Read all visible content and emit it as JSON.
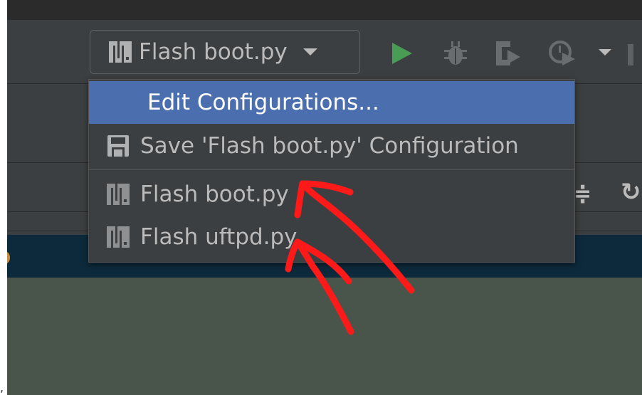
{
  "toolbar": {
    "run_config_label": "Flash boot.py",
    "run_config_icon": "micropython-icon",
    "actions": [
      {
        "name": "run",
        "icon": "run-icon",
        "color": "#499c54"
      },
      {
        "name": "debug",
        "icon": "debug-icon"
      },
      {
        "name": "run-with-coverage",
        "icon": "coverage-icon"
      },
      {
        "name": "profile",
        "icon": "profile-icon"
      },
      {
        "name": "more",
        "icon": "chevron-down-icon"
      }
    ]
  },
  "dropdown": {
    "items": [
      {
        "label": "Edit Configurations...",
        "selected": true
      },
      {
        "label": "Save 'Flash boot.py' Configuration",
        "icon": "save-icon"
      },
      {
        "label": "Flash boot.py",
        "icon": "micropython-icon"
      },
      {
        "label": "Flash uftpd.py",
        "icon": "micropython-icon"
      }
    ]
  },
  "colors": {
    "panel_bg": "#3c3f41",
    "selection": "#4b6eaf",
    "annotation": "#ff1a1a",
    "editor_band": "#0d2a3c",
    "editor_bg": "#49544a"
  }
}
